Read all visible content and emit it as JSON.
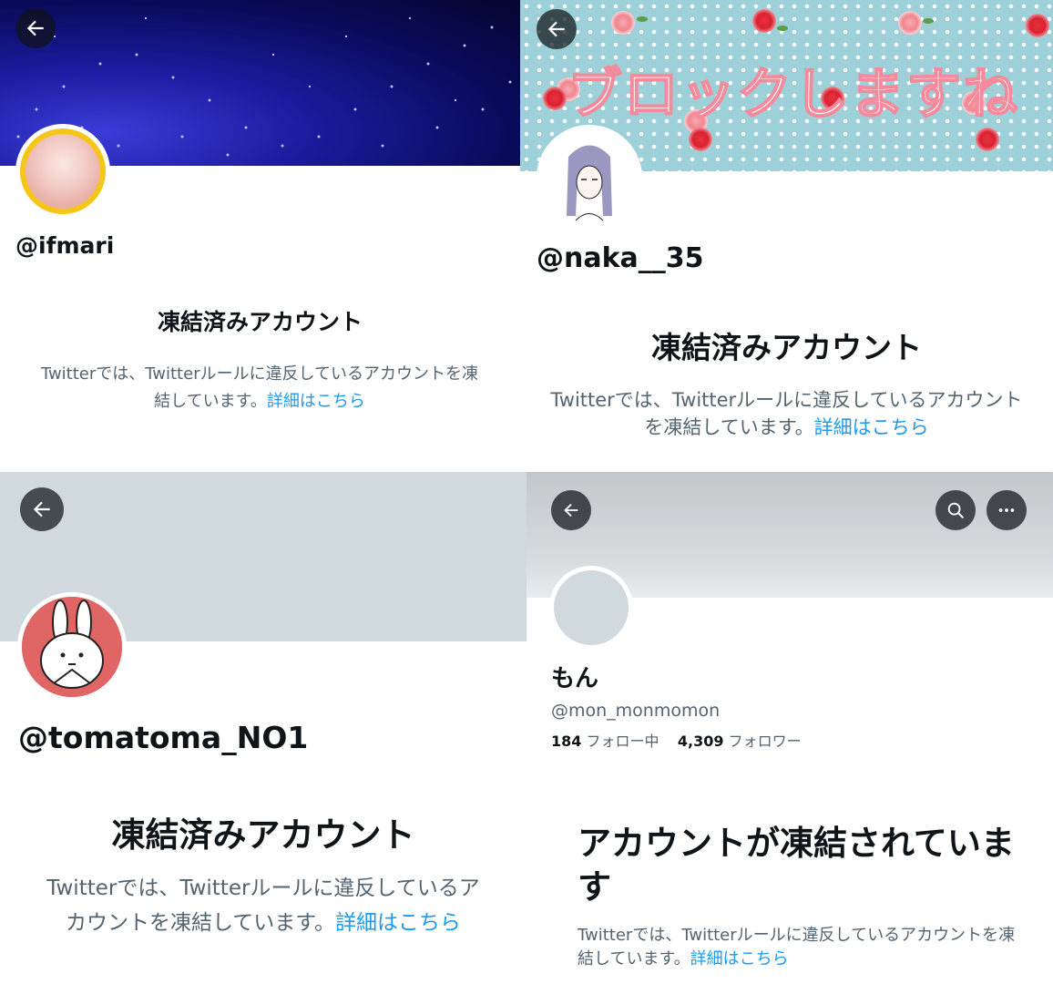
{
  "panels": [
    {
      "handle": "@ifmari",
      "suspended_title": "凍結済みアカウント",
      "desc_text": "Twitterでは、Twitterルールに違反しているアカウントを凍結しています。",
      "link_text": "詳細はこちら",
      "back_icon": "back-arrow-icon"
    },
    {
      "handle": "@naka__35",
      "banner_text": "ブロックしますね",
      "suspended_title": "凍結済みアカウント",
      "desc_text": "Twitterでは、Twitterルールに違反しているアカウントを凍結しています。",
      "link_text": "詳細はこちら",
      "back_icon": "back-arrow-icon"
    },
    {
      "handle": "@tomatoma_NO1",
      "suspended_title": "凍結済みアカウント",
      "desc_text": "Twitterでは、Twitterルールに違反しているアカウントを凍結しています。",
      "link_text": "詳細はこちら",
      "back_icon": "back-arrow-icon"
    },
    {
      "display_name": "もん",
      "handle": "@mon_monmomon",
      "following_count": "184",
      "following_label": "フォロー中",
      "followers_count": "4,309",
      "followers_label": "フォロワー",
      "suspended_title": "アカウントが凍結されています",
      "desc_text": "Twitterでは、Twitterルールに違反しているアカウントを凍結しています。",
      "link_text": "詳細はこちら",
      "back_icon": "back-arrow-icon",
      "search_icon": "search-icon",
      "more_icon": "more-icon"
    }
  ],
  "colors": {
    "link": "#1d9bf0",
    "text_primary": "#0f1419",
    "text_secondary": "#536471",
    "default_banner": "#cfd9de"
  }
}
